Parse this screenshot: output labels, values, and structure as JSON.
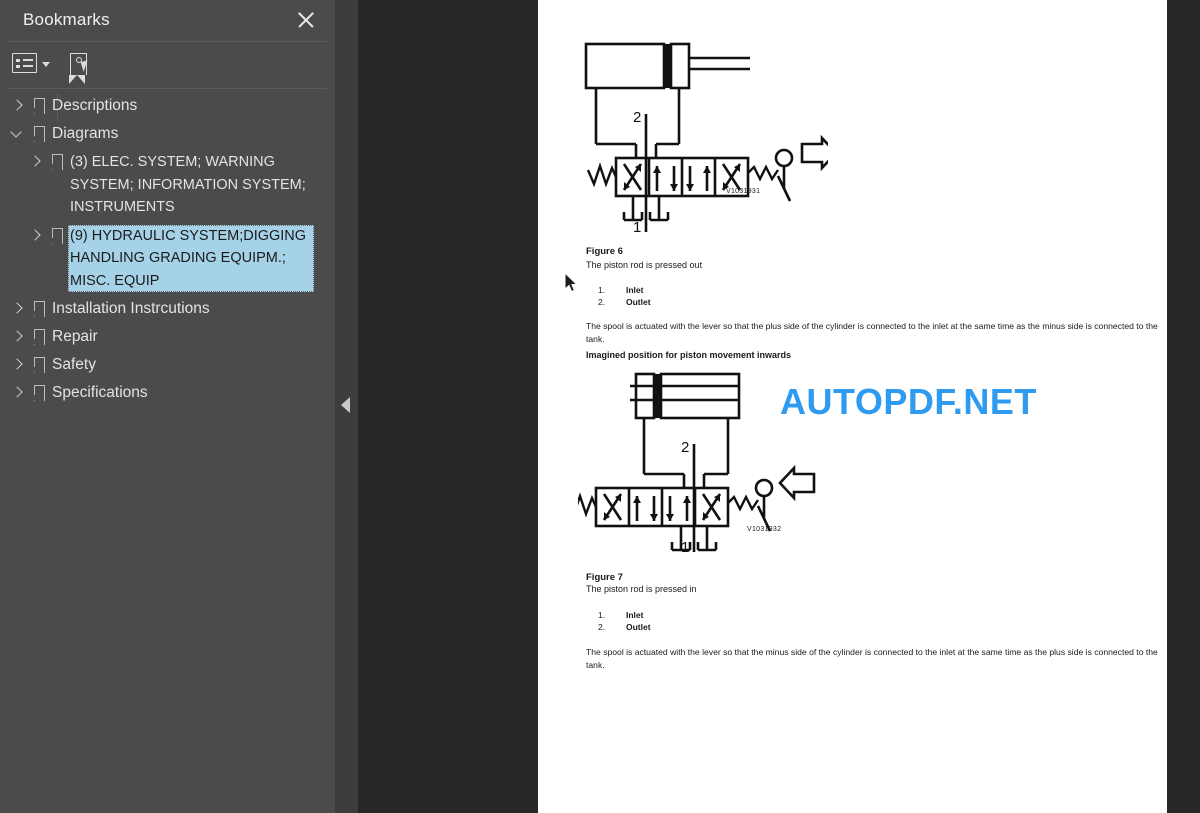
{
  "sidebar": {
    "title": "Bookmarks",
    "close_icon": "close-icon",
    "toolbar": {
      "options_icon": "bookmark-options-list-icon",
      "options_caret": "chevron-down-icon",
      "new_bookmark_icon": "new-bookmark-icon"
    },
    "items": [
      {
        "label": "Descriptions",
        "level": 0,
        "expanded": false,
        "selected": false
      },
      {
        "label": "Diagrams",
        "level": 0,
        "expanded": true,
        "selected": false
      },
      {
        "label": "(3) ELEC. SYSTEM; WARNING SYSTEM; INFORMATION SYSTEM; INSTRUMENTS",
        "level": 1,
        "expanded": false,
        "selected": false
      },
      {
        "label": "(9) HYDRAULIC SYSTEM;DIGGING HANDLING GRADING EQUIPM.; MISC. EQUIP",
        "level": 1,
        "expanded": false,
        "selected": true
      },
      {
        "label": "Installation Instrcutions",
        "level": 0,
        "expanded": false,
        "selected": false
      },
      {
        "label": "Repair",
        "level": 0,
        "expanded": false,
        "selected": false
      },
      {
        "label": "Safety",
        "level": 0,
        "expanded": false,
        "selected": false
      },
      {
        "label": "Specifications",
        "level": 0,
        "expanded": false,
        "selected": false
      }
    ],
    "collapse_handle_icon": "collapse-panel-left-icon"
  },
  "viewer": {
    "watermark": "AUTOPDF.NET",
    "watermark_color": "#2e9bf0",
    "cursor_icon": "mouse-pointer-icon"
  },
  "document": {
    "figure6": {
      "diagram_code": "V1031931",
      "port_top_label": "2",
      "port_bottom_label": "1",
      "title": "Figure 6",
      "subtitle": "The piston rod is pressed out",
      "list": [
        {
          "num": "1.",
          "text": "Inlet"
        },
        {
          "num": "2.",
          "text": "Outlet"
        }
      ],
      "paragraph": "The spool is actuated with the lever so that the plus side of the cylinder is connected to the inlet at the same time as the minus side is connected to the tank.",
      "note": "Imagined position for piston movement inwards"
    },
    "figure7": {
      "diagram_code": "V1031932",
      "port_top_label": "2",
      "port_bottom_label": "1",
      "title": "Figure 7",
      "subtitle": "The piston rod is pressed in",
      "list": [
        {
          "num": "1.",
          "text": "Inlet"
        },
        {
          "num": "2.",
          "text": "Outlet"
        }
      ],
      "paragraph": "The spool is actuated with the lever so that the minus side of the cylinder is connected to the inlet at the same time as the plus side is connected to the tank."
    }
  },
  "colors": {
    "sidebar_bg": "#4b4b4b",
    "viewer_bg": "#272727",
    "page_bg": "#ffffff",
    "selection": "#a6d2e8",
    "accent": "#2e9bf0"
  }
}
